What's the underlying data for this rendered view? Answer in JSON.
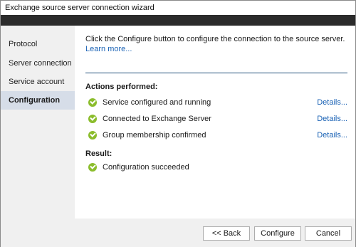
{
  "window": {
    "title": "Exchange source server connection wizard"
  },
  "sidebar": {
    "items": [
      {
        "label": "Protocol",
        "active": false
      },
      {
        "label": "Server connection",
        "active": false
      },
      {
        "label": "Service account",
        "active": false
      },
      {
        "label": "Configuration",
        "active": true
      }
    ]
  },
  "main": {
    "intro": "Click the Configure button to configure the connection to the source server.",
    "learn_more": "Learn more...",
    "actions_heading": "Actions performed:",
    "actions": [
      {
        "label": "Service configured and running",
        "details": "Details..."
      },
      {
        "label": "Connected to Exchange Server",
        "details": "Details..."
      },
      {
        "label": "Group membership confirmed",
        "details": "Details..."
      }
    ],
    "result_heading": "Result:",
    "result": {
      "label": "Configuration succeeded"
    }
  },
  "footer": {
    "back_label": "<< Back",
    "configure_label": "Configure",
    "cancel_label": "Cancel"
  },
  "colors": {
    "header_band": "#2b2b2b",
    "sidebar_bg": "#f0f0f0",
    "active_item_bg": "#d6dde8",
    "link": "#1a62b5",
    "success_icon": "#8bbd2c",
    "divider": "#1f4e79"
  }
}
